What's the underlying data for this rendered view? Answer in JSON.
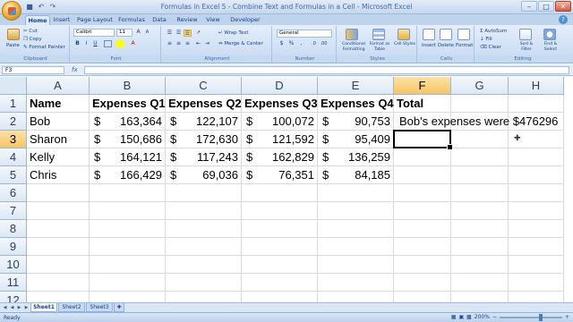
{
  "window": {
    "title": "Formulas in Excel 5 - Combine Text and Formulas in a Cell - Microsoft Excel",
    "controls": [
      "–",
      "□",
      "✕"
    ]
  },
  "ribbon_tabs": [
    "Home",
    "Insert",
    "Page Layout",
    "Formulas",
    "Data",
    "Review",
    "View",
    "Developer"
  ],
  "ribbon": {
    "clipboard": {
      "label": "Clipboard",
      "paste": "Paste",
      "cut": "Cut",
      "copy": "Copy",
      "format_painter": "Format Painter"
    },
    "font": {
      "label": "Font",
      "name": "Calibri",
      "size": "11",
      "bold": "B",
      "italic": "I",
      "underline": "U"
    },
    "alignment": {
      "label": "Alignment",
      "wrap_text": "Wrap Text",
      "merge_center": "Merge & Center"
    },
    "number": {
      "label": "Number",
      "format": "General",
      "currency": "$",
      "percent": "%",
      "comma": ","
    },
    "styles": {
      "label": "Styles",
      "conditional": "Conditional Formatting",
      "format_table": "Format as Table",
      "cell_styles": "Cell Styles"
    },
    "cells": {
      "label": "Cells",
      "insert": "Insert",
      "delete": "Delete",
      "format": "Format"
    },
    "editing": {
      "label": "Editing",
      "autosum": "AutoSum",
      "fill": "Fill",
      "clear": "Clear",
      "sort_filter": "Sort & Filter",
      "find_select": "Find & Select"
    }
  },
  "formula_bar": {
    "name_box": "F3",
    "fx": "fx",
    "formula": ""
  },
  "grid": {
    "columns": [
      "A",
      "B",
      "C",
      "D",
      "E",
      "F",
      "G",
      "H"
    ],
    "rows": [
      "1",
      "2",
      "3",
      "4",
      "5",
      "6",
      "7",
      "8",
      "9",
      "10",
      "11",
      "12"
    ],
    "header_row": [
      "Name",
      "Expenses Q1",
      "Expenses Q2",
      "Expenses Q3",
      "Expenses Q4",
      "Total"
    ],
    "data": [
      {
        "name": "Bob",
        "q": [
          "163,364",
          "122,107",
          "100,072",
          "90,753"
        ],
        "note": "Bob's expenses were $476296"
      },
      {
        "name": "Sharon",
        "q": [
          "150,686",
          "172,630",
          "121,592",
          "95,409"
        ],
        "note": ""
      },
      {
        "name": "Kelly",
        "q": [
          "164,121",
          "117,243",
          "162,829",
          "136,259"
        ],
        "note": ""
      },
      {
        "name": "Chris",
        "q": [
          "166,429",
          "69,036",
          "76,351",
          "84,185"
        ],
        "note": ""
      }
    ],
    "currency_symbol": "$",
    "active_cell": "F3"
  },
  "sheets": [
    "Sheet1",
    "Sheet2",
    "Sheet3"
  ],
  "status": {
    "text": "Ready",
    "zoom": "200%"
  },
  "colors": {
    "accent": "#15428b",
    "ribbon": "#cfdff4",
    "selected_header": "#f7c562"
  }
}
